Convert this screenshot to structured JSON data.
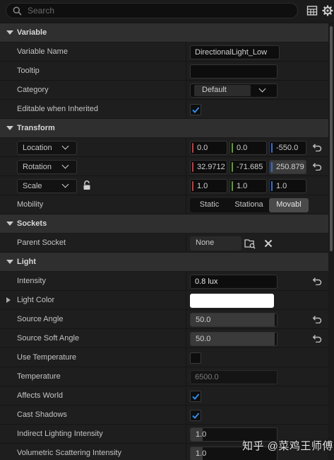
{
  "search": {
    "placeholder": "Search"
  },
  "toolbar": {
    "table_icon": "table-icon",
    "settings_icon": "gear-icon"
  },
  "sections": {
    "variable": {
      "title": "Variable",
      "variable_name": {
        "label": "Variable Name",
        "value": "DirectionalLight_Low"
      },
      "tooltip": {
        "label": "Tooltip",
        "value": ""
      },
      "category": {
        "label": "Category",
        "value": "Default"
      },
      "editable": {
        "label": "Editable when Inherited",
        "checked": true
      }
    },
    "transform": {
      "title": "Transform",
      "location": {
        "label": "Location",
        "x": "0.0",
        "y": "0.0",
        "z": "-550.0"
      },
      "rotation": {
        "label": "Rotation",
        "x": "32.9712",
        "y": "-71.685",
        "z": "250.879"
      },
      "scale": {
        "label": "Scale",
        "x": "1.0",
        "y": "1.0",
        "z": "1.0"
      },
      "mobility": {
        "label": "Mobility",
        "options": [
          "Static",
          "Stationa",
          "Movabl"
        ],
        "selected": "Movabl"
      }
    },
    "sockets": {
      "title": "Sockets",
      "parent_socket": {
        "label": "Parent Socket",
        "value": "None"
      }
    },
    "light": {
      "title": "Light",
      "intensity": {
        "label": "Intensity",
        "value": "0.8 lux"
      },
      "light_color": {
        "label": "Light Color",
        "color": "#ffffff"
      },
      "source_angle": {
        "label": "Source Angle",
        "value": "50.0"
      },
      "source_soft_angle": {
        "label": "Source Soft Angle",
        "value": "50.0"
      },
      "use_temperature": {
        "label": "Use Temperature",
        "checked": false
      },
      "temperature": {
        "label": "Temperature",
        "value": "6500.0"
      },
      "affects_world": {
        "label": "Affects World",
        "checked": true
      },
      "cast_shadows": {
        "label": "Cast Shadows",
        "checked": true
      },
      "indirect_lighting_intensity": {
        "label": "Indirect Lighting Intensity",
        "value": "1.0"
      },
      "volumetric_scattering_intensity": {
        "label": "Volumetric Scattering Intensity",
        "value": "1.0"
      }
    }
  },
  "watermark": "知乎 @菜鸡王师傅",
  "colors": {
    "axis_x": "#c43a3a",
    "axis_y": "#5aa02c",
    "axis_z": "#2f6fd6",
    "check": "#2f8be6"
  }
}
